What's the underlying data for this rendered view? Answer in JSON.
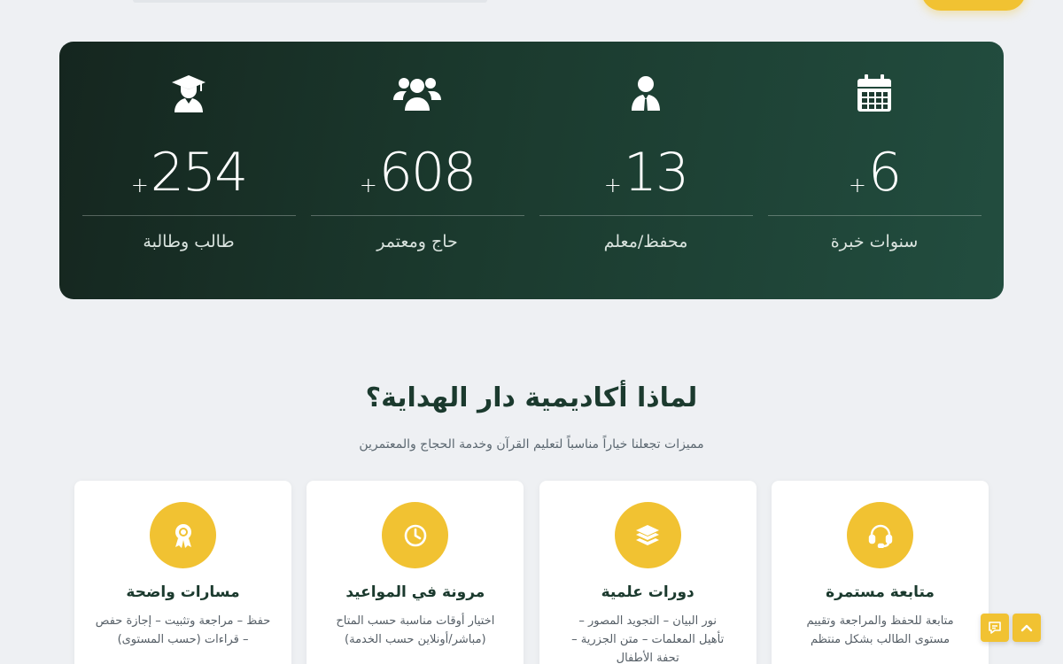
{
  "stats": [
    {
      "icon": "graduate-icon",
      "plus": "+",
      "number": "254",
      "label": "طالب وطالبة"
    },
    {
      "icon": "group-icon",
      "plus": "+",
      "number": "608",
      "label": "حاج ومعتمر"
    },
    {
      "icon": "user-tie-icon",
      "plus": "+",
      "number": "13",
      "label": "محفظ/معلم"
    },
    {
      "icon": "calendar-icon",
      "plus": "+",
      "number": "6",
      "label": "سنوات خبرة"
    }
  ],
  "why": {
    "title": "لماذا أكاديمية دار الهداية؟",
    "subtitle": "مميزات تجعلنا خياراً مناسباً لتعليم القرآن وخدمة الحجاج والمعتمرين"
  },
  "features": [
    {
      "icon": "award-icon",
      "title": "مسارات واضحة",
      "desc_lines": [
        "حفظ – مراجعة وتثبيت – إجازة حفص",
        "– قراءات (حسب المستوى)"
      ]
    },
    {
      "icon": "clock-icon",
      "title": "مرونة في المواعيد",
      "desc_lines": [
        "اختيار أوقات مناسبة حسب المتاح",
        "(مباشر/أونلاين حسب الخدمة)"
      ]
    },
    {
      "icon": "layers-icon",
      "title": "دورات علمية",
      "desc_lines": [
        "نور البيان – التجويد المصور –",
        "تأهيل المعلمات – متن الجزرية –",
        "تحفة الأطفال"
      ]
    },
    {
      "icon": "headset-icon",
      "title": "متابعة مستمرة",
      "desc_lines": [
        "متابعة للحفظ والمراجعة وتقييم",
        "مستوى الطالب بشكل منتظم"
      ]
    }
  ],
  "colors": {
    "accent": "#f1c232",
    "dark_green": "#1b3a2e",
    "background": "#eef0f3"
  },
  "floating": {
    "scroll_top_icon": "chevron-up-icon",
    "chat_icon": "chat-icon"
  }
}
